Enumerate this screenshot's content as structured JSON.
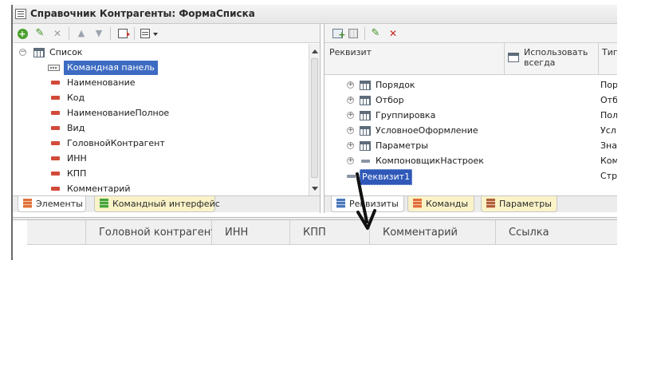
{
  "window": {
    "title": "Справочник Контрагенты: ФормаСписка"
  },
  "left_toolbar": {
    "icons": [
      "add-icon",
      "edit-icon",
      "delete-icon",
      "move-up-icon",
      "move-down-icon",
      "form-icon",
      "menu-icon"
    ]
  },
  "elements_tree": {
    "root": {
      "label": "Список",
      "icon": "table-icon",
      "expander": "−"
    },
    "items": [
      {
        "label": "Командная панель",
        "icon": "command-panel-icon",
        "selected": true
      },
      {
        "label": "Наименование",
        "icon": "field-icon"
      },
      {
        "label": "Код",
        "icon": "field-icon"
      },
      {
        "label": "НаименованиеПолное",
        "icon": "field-icon"
      },
      {
        "label": "Вид",
        "icon": "field-icon"
      },
      {
        "label": "ГоловнойКонтрагент",
        "icon": "field-icon"
      },
      {
        "label": "ИНН",
        "icon": "field-icon"
      },
      {
        "label": "КПП",
        "icon": "field-icon"
      },
      {
        "label": "Комментарий",
        "icon": "field-icon"
      }
    ]
  },
  "left_tabs": [
    {
      "label": "Элементы",
      "active": true
    },
    {
      "label": "Командный интерфейс",
      "active": false
    }
  ],
  "right_toolbar": {
    "icons": [
      "add-table-icon",
      "grid-icon",
      "edit-icon",
      "delete-icon"
    ]
  },
  "attributes_table": {
    "columns": {
      "name": "Реквизит",
      "always_use": "Использовать всегда",
      "type": "Тип"
    },
    "rows": [
      {
        "name": "Порядок",
        "type": "Пор"
      },
      {
        "name": "Отбор",
        "type": "Отб"
      },
      {
        "name": "Группировка",
        "type": "Пол"
      },
      {
        "name": "УсловноеОформление",
        "type": "Усл"
      },
      {
        "name": "Параметры",
        "type": "Зна"
      },
      {
        "name": "КомпоновщикНастроек",
        "type": "Ком"
      },
      {
        "name": "Реквизит1",
        "type": "Стр",
        "selected": true
      }
    ]
  },
  "right_tabs": [
    {
      "label": "Реквизиты",
      "active": true
    },
    {
      "label": "Команды",
      "active": false
    },
    {
      "label": "Параметры",
      "active": false
    }
  ],
  "list_preview": {
    "columns": [
      "Головной контрагент",
      "ИНН",
      "КПП",
      "Комментарий",
      "Ссылка"
    ]
  },
  "colors": {
    "selection": "#3d6bc2",
    "tab_inactive": "#fbf3c8",
    "field_icon": "#d24a3a"
  }
}
